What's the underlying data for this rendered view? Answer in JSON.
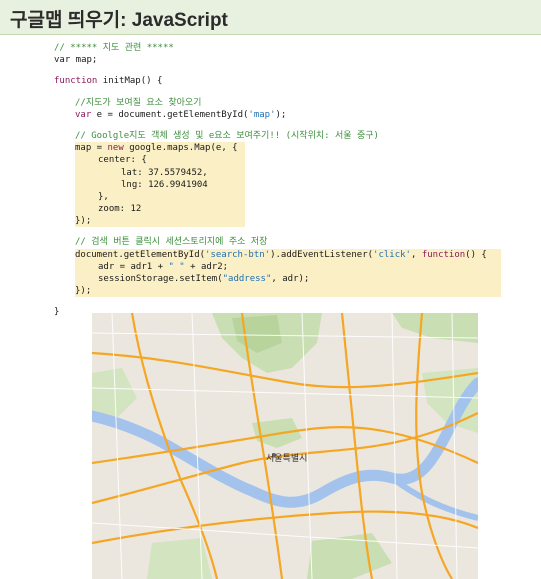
{
  "page": {
    "title": "구글맵 띄우기: JavaScript"
  },
  "code": {
    "comment_header": "// ***** 지도 관련 *****",
    "var_map": "var map;",
    "func_keyword": "function",
    "func_sig": " initMap() {",
    "comment_find": "//지도가 보여질 요소 찾아오기",
    "var_e_kw": "var",
    "var_e_rest": " e = document.getElementById(",
    "map_id": "'map'",
    "close_paren": ");",
    "comment_create": "// Goolgle지도 객체 생성 및 e요소 보여주기!! (시작위치: 서울 중구)",
    "map_assign": "map = ",
    "new_kw": "new",
    "map_ctor": " google.maps.Map(e, {",
    "center_open": "center: {",
    "lat_line": "lat: 37.5579452,",
    "lng_line": "lng: 126.9941904",
    "center_close": "},",
    "zoom_line": "zoom: 12",
    "map_close": "});",
    "comment_search": "// 검색 버튼 클릭시 세션스토리지에 주소 저장",
    "listener_a": "document.getElementById(",
    "btn_id": "'search-btn'",
    "listener_b": ").addEventListener(",
    "click_str": "'click'",
    "listener_c": ", ",
    "listener_fn": "function",
    "listener_d": "() {",
    "adr_a": "adr = adr1 + ",
    "space_str": "\" \"",
    "adr_b": " + adr2;",
    "session_a": "sessionStorage.setItem(",
    "address_str": "\"address\"",
    "session_b": ", adr);",
    "listener_close": "});",
    "func_close": "}"
  },
  "map": {
    "city_label": "서울특별시",
    "colors": {
      "land": "#ebe7df",
      "park": "#c9dfb3",
      "water": "#a3c3ec",
      "road": "#f5a623"
    }
  }
}
